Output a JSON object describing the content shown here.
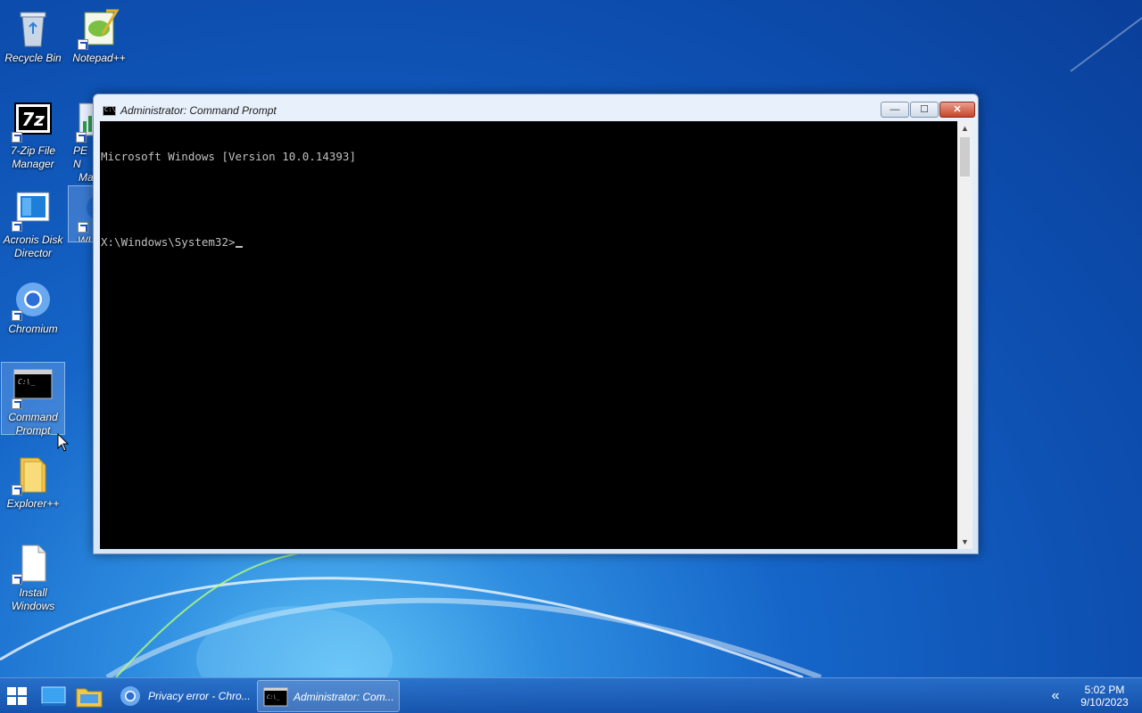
{
  "desktop": {
    "icons": [
      {
        "label": "Recycle Bin"
      },
      {
        "label": "Notepad++"
      },
      {
        "label": "7-Zip File Manager"
      },
      {
        "label": "PE N... Ma..."
      },
      {
        "label": "Acronis Disk Director"
      },
      {
        "label": "Wi..."
      },
      {
        "label": "Chromium"
      },
      {
        "label": "Command Prompt"
      },
      {
        "label": "Explorer++"
      },
      {
        "label": "Install Windows"
      }
    ],
    "partial_labels": {
      "pe_line1": "PE N",
      "pe_line2": "Ma",
      "wi": "WI"
    }
  },
  "cmd_window": {
    "title": "Administrator: Command Prompt",
    "icon_glyph": "C:\\",
    "controls": {
      "minimize": "—",
      "maximize": "☐",
      "close": "✕"
    },
    "console_lines": [
      "Microsoft Windows [Version 10.0.14393]",
      "",
      "X:\\Windows\\System32>"
    ],
    "scroll": {
      "up": "▲",
      "down": "▼"
    }
  },
  "taskbar": {
    "tasks": [
      {
        "label": "Privacy error - Chro..."
      },
      {
        "label": "Administrator: Com..."
      }
    ],
    "tray_chevron": "«",
    "clock": {
      "time": "5:02 PM",
      "date": "9/10/2023"
    }
  },
  "colors": {
    "console_bg": "#000000",
    "console_fg": "#c0c0c0",
    "close_red": "#c8432a"
  }
}
